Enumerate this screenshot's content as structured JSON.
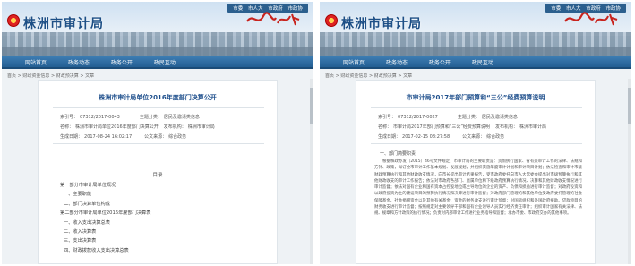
{
  "site": {
    "top_links": [
      "市委",
      "市人大",
      "市政府",
      "市政协"
    ],
    "title": "株洲市审计局",
    "nav": [
      "网站首页",
      "政务动态",
      "政务公开",
      "政民互动"
    ]
  },
  "left": {
    "breadcrumb": "首页 > 财政资金信息 > 财政预决算 > 文章",
    "doc_title": "株洲市审计局单位2016年度部门决算公开",
    "meta": {
      "index_label": "索引号：",
      "index": "07312/2017-0043",
      "category_label": "主题分类：",
      "category": "居民及邀请类信息",
      "name_label": "名称：",
      "name": "株洲市审计局单位2016年度部门决算公开",
      "issuer_label": "发布机构：",
      "issuer": "株洲市审计局",
      "date_label": "生成日期：",
      "date": "2017-08-24 16:02:17",
      "source_label": "公文来源：",
      "source": "综合政务"
    },
    "toc_title": "目录",
    "toc": [
      "第一部分市审计局单位概况",
      "一、主要职能",
      "二、部门决算单位构成",
      "第二部分市审计局单位2016年度部门决算表",
      "一、收入支出决算总表",
      "二、收入决算表",
      "三、支出决算表",
      "四、财政拨款收入支出决算总表"
    ]
  },
  "right": {
    "breadcrumb": "首页 > 财政资金信息 > 财政预决算 > 文章",
    "doc_title": "市审计局2017年部门预算和“三公”经费预算说明",
    "meta": {
      "index_label": "索引号：",
      "index": "07312/2017-0027",
      "category_label": "主题分类：",
      "category": "居民及邀请类信息",
      "name_label": "名称：",
      "name": "市审计局2017年部门预算和“三公”经费预算说明",
      "issuer_label": "发布机构：",
      "issuer": "株洲市审计局",
      "date_label": "生成日期：",
      "date": "2017-02-15 08:27:58",
      "source_label": "公文来源：",
      "source": "综合政务"
    },
    "section_head": "一、部门简要职责",
    "body": "根据株政办发〔2015〕46号文件规定，市审计局的主要职责是：贯彻执行国家、省有关审计工作的法律、法规和方针、政策，拟订全市审计工作基本规划、发展规划，并组织实施年度审计计划和审计项目计划；依法检查和审计市级财政预算执行和其他财政收支情况，向市长提出审计结果报告，受市政府委托向市人大常委会提出对市级预算执行和其他财政收支的审计工作报告；依法对市政府各部门、直属单位和下级政府预算执行情况、决算和其他财政收支情况进行审计监督；依法对国有企业和国有资本占控股地位或主导地位的企业的资产、负债和损益进行审计监督；对政府投资和以政府投资为主的建设项目的预算执行情况和决算进行审计监督；对政府部门管理的和其他单位受政府委托管理的社会保障基金、社会捐赠资金以及其他有关基金、资金的财务收支进行审计监督；对国际组织和外国政府援助、贷款项目的财务收支进行审计监督；按照规定对主要领导干部和国有企业领导人员实行经济责任审计；组织审计国家有关法律、法规、规章和方针政策的执行情况；负责对内部审计工作进行业务指导和监督；承办市委、市政府交办的其他事项。"
  }
}
